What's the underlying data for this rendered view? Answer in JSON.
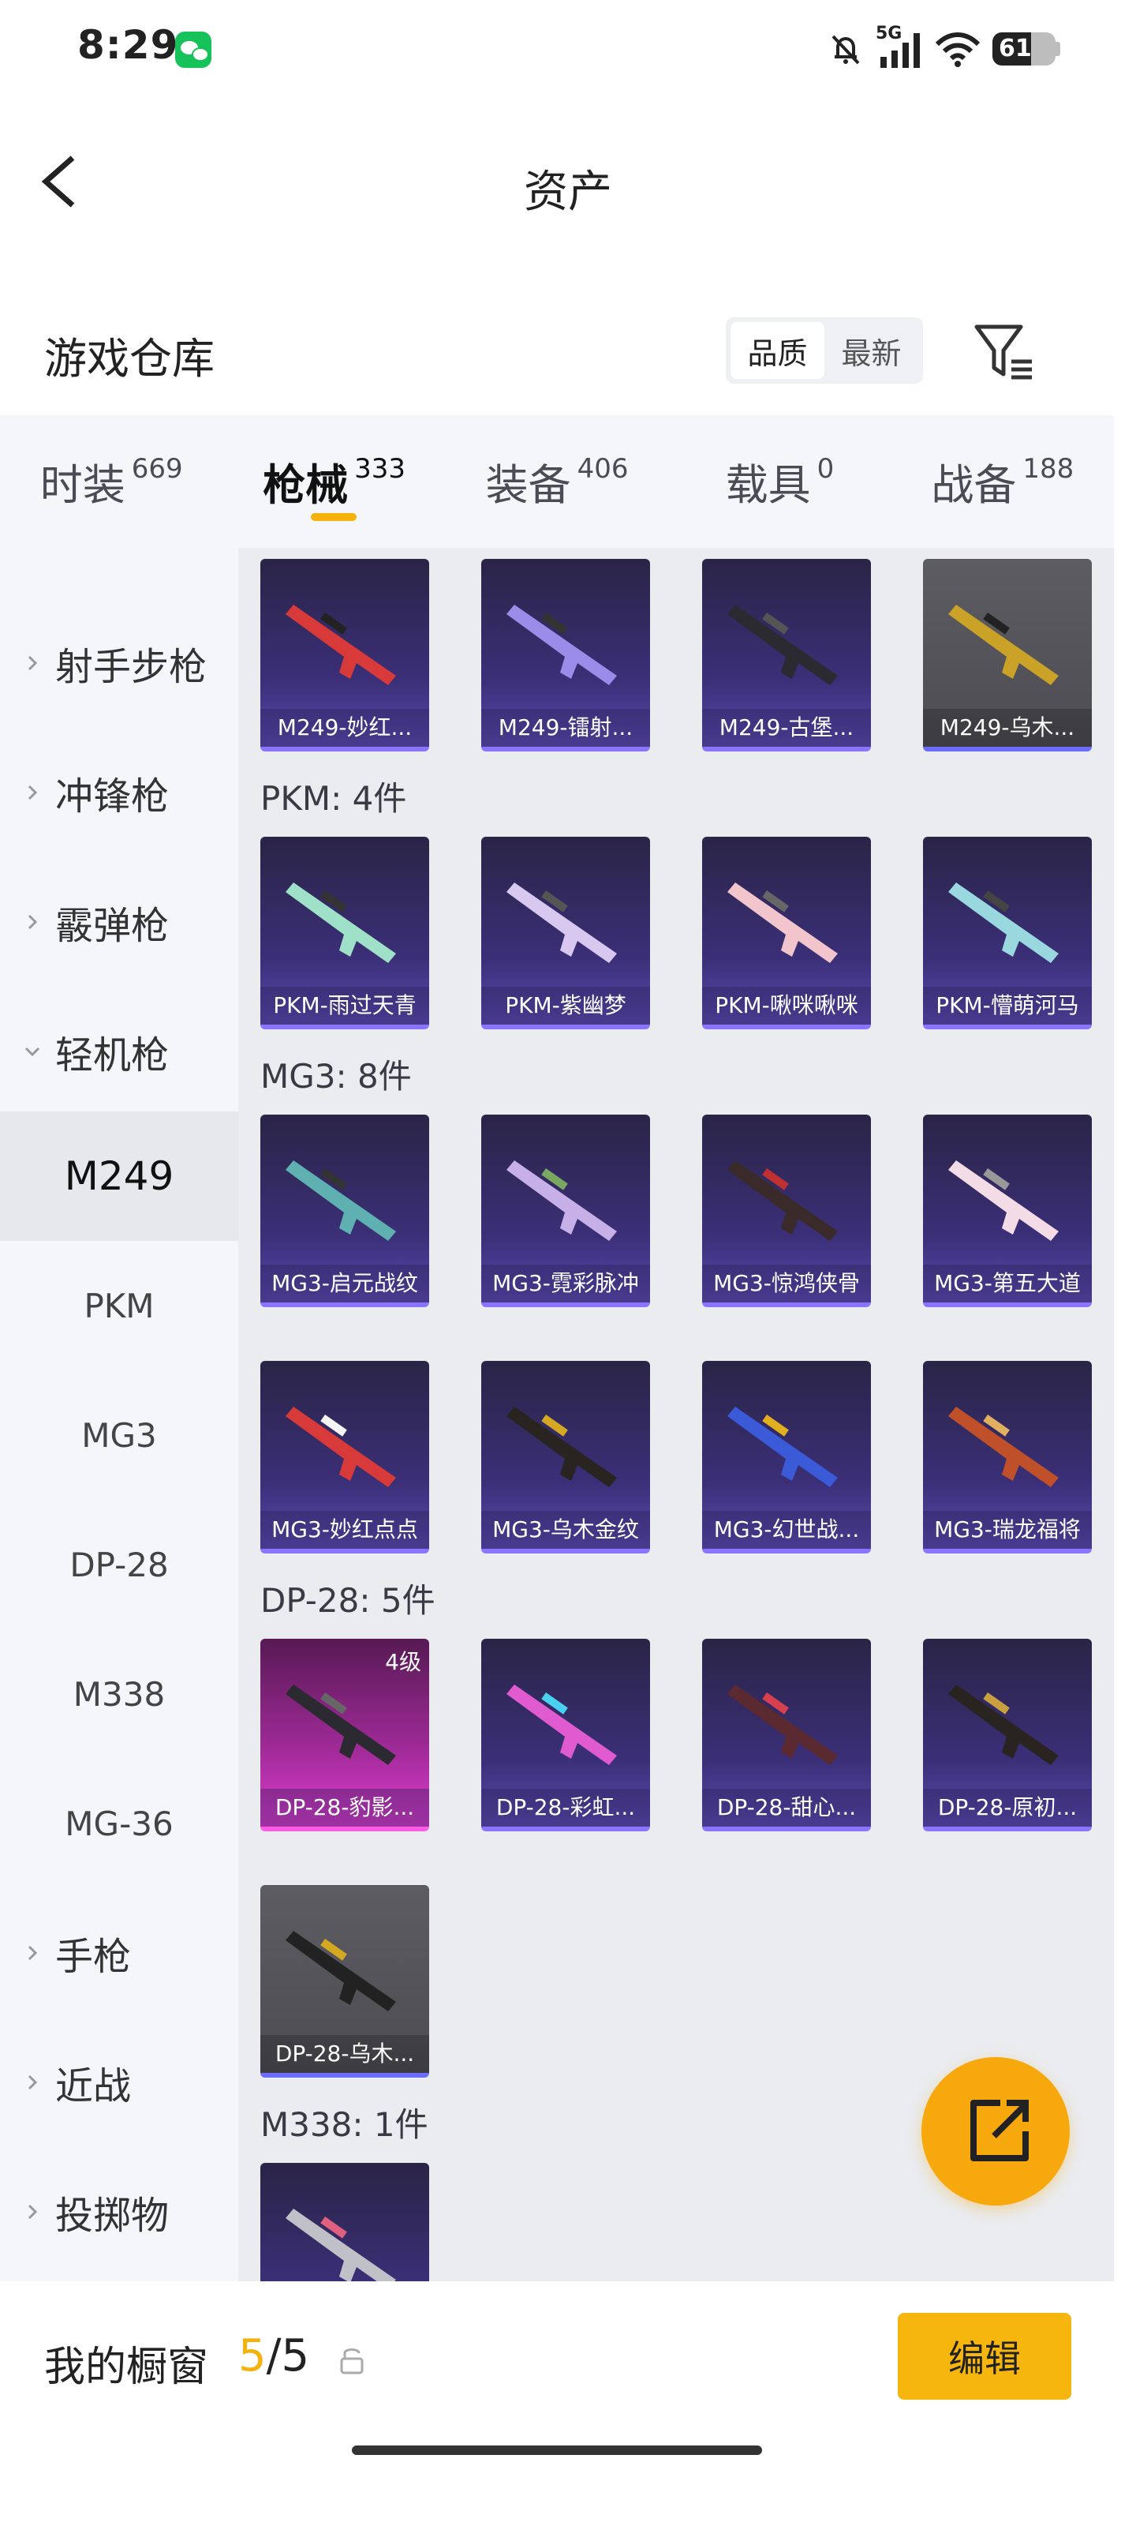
{
  "status": {
    "time": "8:29",
    "network": "5G",
    "battery": "61",
    "battery_level": 0.61
  },
  "header": {
    "title": "资产"
  },
  "warehouse": {
    "title": "游戏仓库",
    "sort_quality": "品质",
    "sort_latest": "最新"
  },
  "tabs": [
    {
      "label": "时装",
      "count": "669"
    },
    {
      "label": "枪械",
      "count": "333"
    },
    {
      "label": "装备",
      "count": "406"
    },
    {
      "label": "载具",
      "count": "0"
    },
    {
      "label": "战备",
      "count": "188"
    }
  ],
  "sidebar": {
    "categories": [
      {
        "label": "射手步枪"
      },
      {
        "label": "冲锋枪"
      },
      {
        "label": "霰弹枪"
      },
      {
        "label": "轻机枪"
      },
      {
        "label": "手枪"
      },
      {
        "label": "近战"
      },
      {
        "label": "投掷物"
      }
    ],
    "sub_items": [
      "M249",
      "PKM",
      "MG3",
      "DP-28",
      "M338",
      "MG-36"
    ]
  },
  "groups": {
    "m249": {
      "items": [
        "M249-妙红...",
        "M249-镭射...",
        "M249-古堡...",
        "M249-乌木..."
      ]
    },
    "pkm": {
      "label": "PKM: 4件",
      "items": [
        "PKM-雨过天青",
        "PKM-紫幽梦",
        "PKM-啾咪啾咪",
        "PKM-懵萌河马"
      ]
    },
    "mg3": {
      "label": "MG3: 8件",
      "items": [
        "MG3-启元战纹",
        "MG3-霓彩脉冲",
        "MG3-惊鸿侠骨",
        "MG3-第五大道",
        "MG3-妙红点点",
        "MG3-乌木金纹",
        "MG3-幻世战...",
        "MG3-瑞龙福将"
      ]
    },
    "dp28": {
      "label": "DP-28: 5件",
      "level": "4级",
      "items": [
        "DP-28-豹影...",
        "DP-28-彩虹...",
        "DP-28-甜心...",
        "DP-28-原初...",
        "DP-28-乌木..."
      ]
    },
    "m338": {
      "label": "M338: 1件"
    }
  },
  "colors": {
    "accent": "#f5b10c",
    "purple_card": "#3b2f78",
    "pink_card": "#a22b9a"
  },
  "bottom": {
    "showcase_label": "我的橱窗",
    "showcase_current": "5",
    "showcase_total": "/5",
    "edit": "编辑"
  }
}
